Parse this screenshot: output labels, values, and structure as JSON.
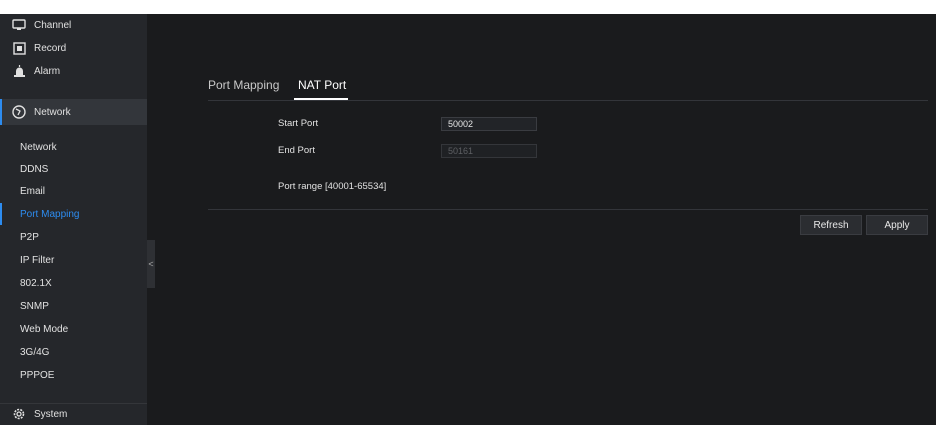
{
  "sidebar": {
    "main_items": [
      {
        "label": "Channel",
        "icon": "monitor-icon"
      },
      {
        "label": "Record",
        "icon": "record-icon"
      },
      {
        "label": "Alarm",
        "icon": "alarm-icon"
      },
      {
        "label": "Network",
        "icon": "network-globe-icon",
        "active": true
      }
    ],
    "sub_items": [
      "Network",
      "DDNS",
      "Email",
      "Port Mapping",
      "P2P",
      "IP Filter",
      "802.1X",
      "SNMP",
      "Web Mode",
      "3G/4G",
      "PPPOE"
    ],
    "active_sub": "Port Mapping",
    "system": {
      "label": "System",
      "icon": "gear-icon"
    },
    "collapse_glyph": "<"
  },
  "tabs": [
    {
      "label": "Port Mapping",
      "active": false
    },
    {
      "label": "NAT Port",
      "active": true
    }
  ],
  "form": {
    "start_port": {
      "label": "Start Port",
      "value": "50002"
    },
    "end_port": {
      "label": "End Port",
      "value": "50161",
      "disabled": true
    },
    "port_range": "Port range [40001-65534]"
  },
  "buttons": {
    "refresh": "Refresh",
    "apply": "Apply"
  },
  "colors": {
    "accent": "#2d8cf0",
    "background": "#1a1b1d",
    "sidebar": "#25272b"
  }
}
